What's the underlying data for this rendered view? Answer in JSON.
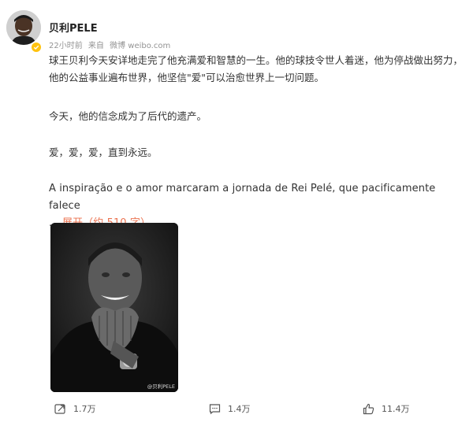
{
  "post": {
    "author": "贝利PELE",
    "time": "22小时前",
    "source_prefix": "来自",
    "source": "微博 weibo.com",
    "paragraphs": [
      "球王贝利今天安详地走完了他充满爱和智慧的一生。他的球技令世人着迷，他为停战做出努力，他的公益事业遍布世界，他坚信\"爱\"可以治愈世界上一切问题。",
      "今天，他的信念成为了后代的遗产。",
      "爱，爱，爱，直到永远。",
      "A inspiração e o amor marcaram a jornada de Rei Pelé, que pacificamente falece"
    ],
    "ellipsis": "...",
    "expand_label": "展开（约 510 字）",
    "image_watermark": "@贝利PELE"
  },
  "actions": {
    "repost": "1.7万",
    "comment": "1.4万",
    "like": "11.4万"
  },
  "colors": {
    "accent": "#eb7350",
    "verified_badge": "#ffc20e",
    "meta_text": "#939393"
  },
  "icons": [
    "verified-badge-icon",
    "repost-icon",
    "comment-icon",
    "like-icon"
  ]
}
